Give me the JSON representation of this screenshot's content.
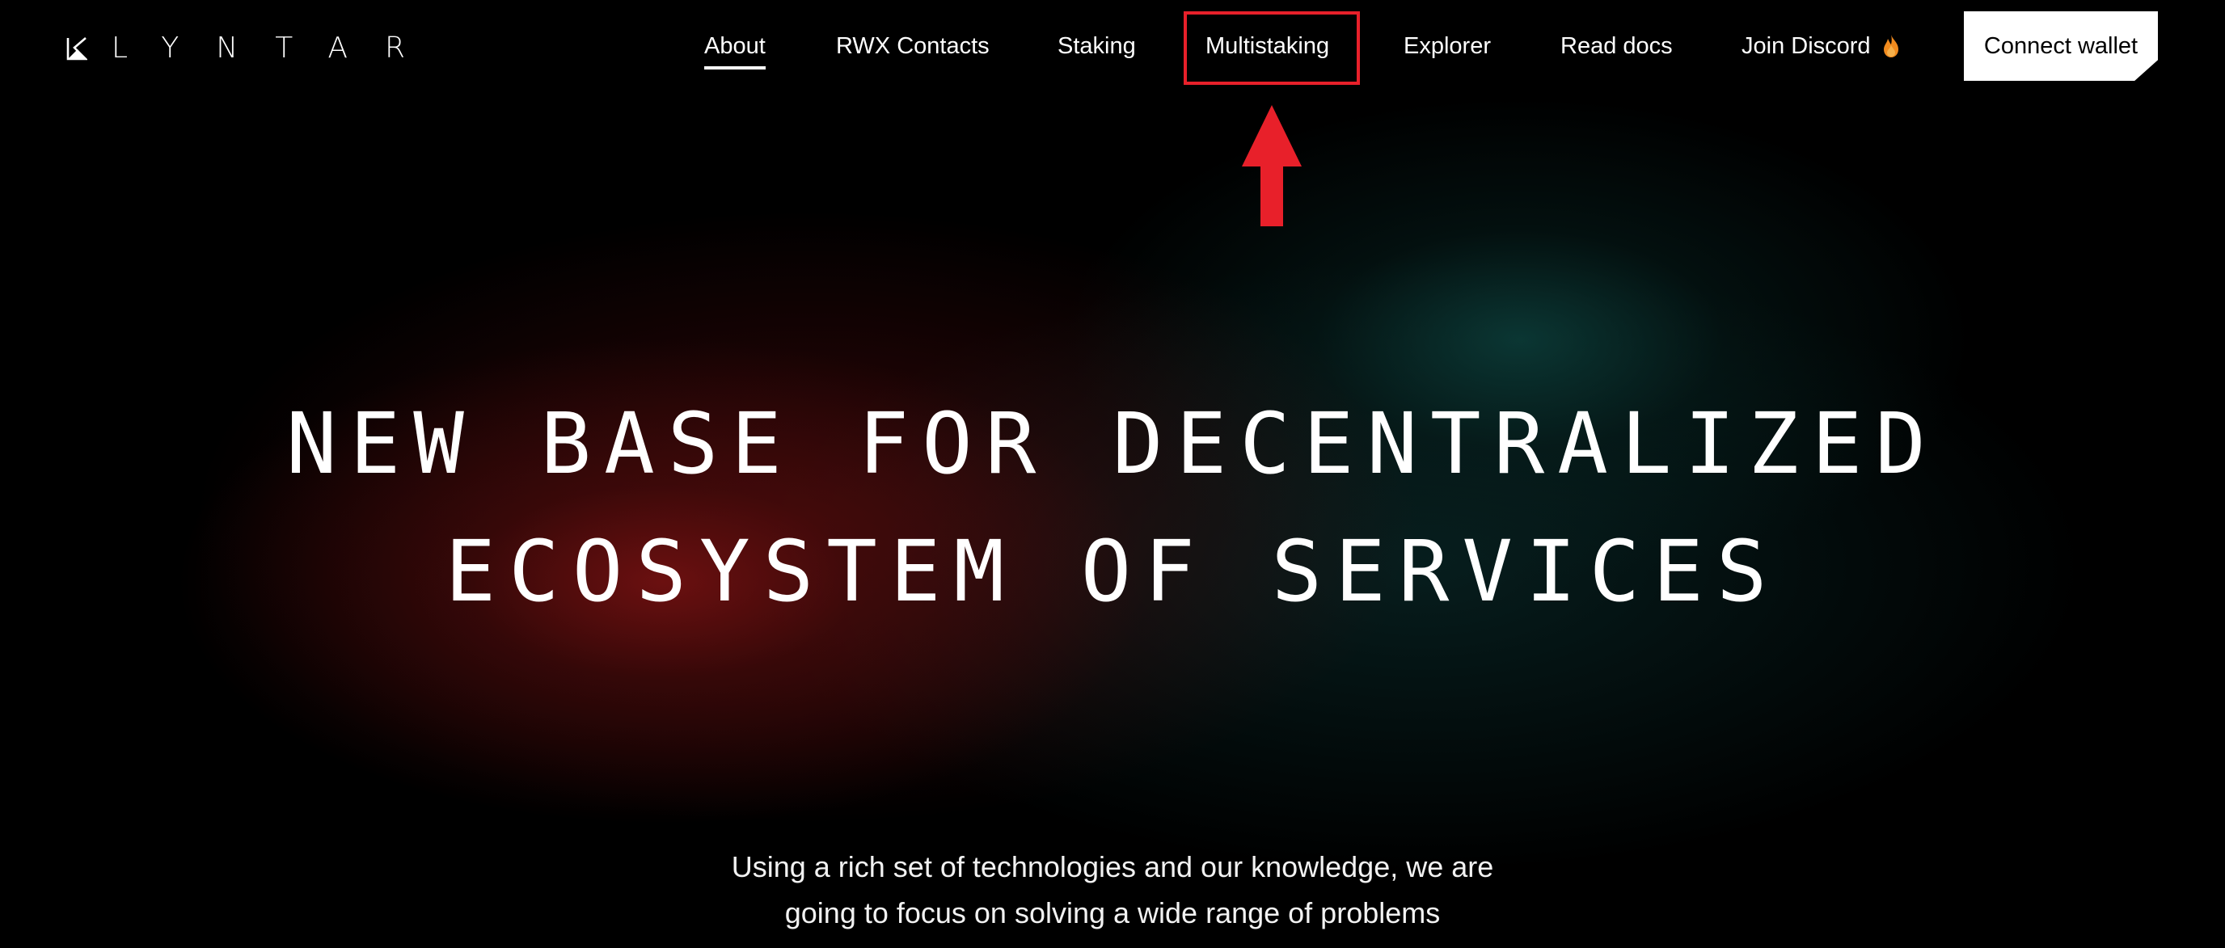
{
  "brand": {
    "name": "KLYNTAR",
    "logo_letters": "LYNTAR"
  },
  "nav": {
    "items": [
      {
        "label": "About",
        "active": true
      },
      {
        "label": "RWX Contacts"
      },
      {
        "label": "Staking"
      },
      {
        "label": "Multistaking",
        "highlighted": true
      },
      {
        "label": "Explorer"
      },
      {
        "label": "Read docs"
      },
      {
        "label": "Join Discord",
        "icon": "flame-icon"
      }
    ],
    "cta": "Connect wallet"
  },
  "hero": {
    "title_line1": "NEW BASE FOR DECENTRALIZED",
    "title_line2": "ECOSYSTEM OF SERVICES",
    "subtitle_line1": "Using a rich set of technologies and our knowledge, we are",
    "subtitle_line2": "going to focus on solving a wide range of problems"
  },
  "colors": {
    "background": "#000000",
    "text": "#ffffff",
    "annotation": "#e8202a",
    "glow_red": "#7a1212",
    "glow_teal": "#0e4642",
    "flame": "#f28b1e"
  },
  "icons": {
    "logo": "klyntar-logo-mark",
    "discord_suffix": "flame-icon",
    "annotation": "red-arrow-up-icon"
  }
}
